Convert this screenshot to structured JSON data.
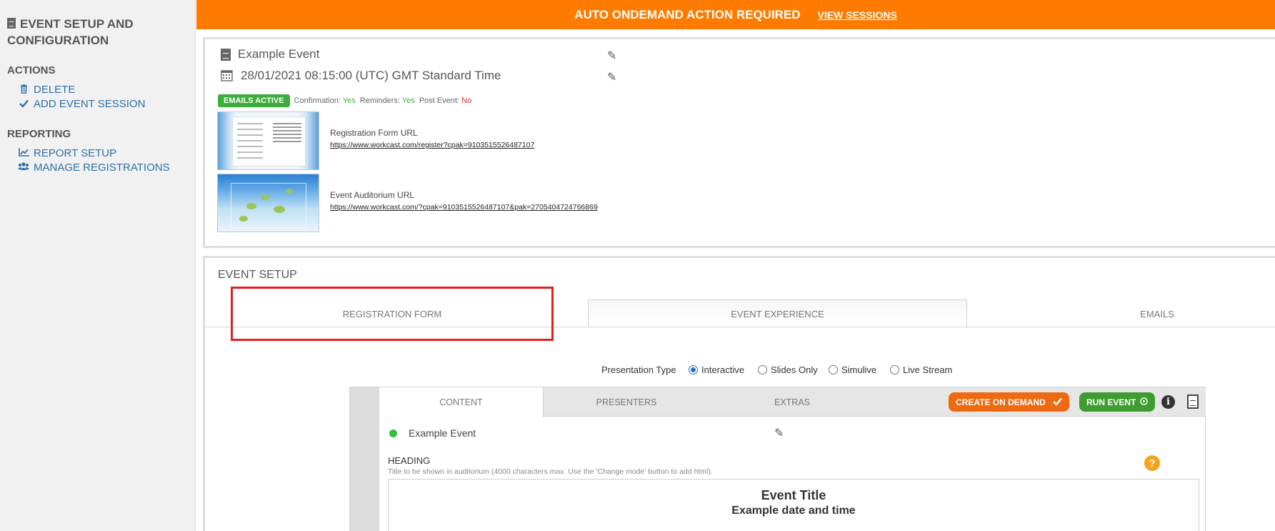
{
  "sidebar": {
    "title": "EVENT SETUP AND CONFIGURATION",
    "actions_heading": "ACTIONS",
    "actions": [
      {
        "label": "DELETE",
        "icon": "trash-icon"
      },
      {
        "label": "ADD EVENT SESSION",
        "icon": "check-icon"
      }
    ],
    "reporting_heading": "REPORTING",
    "reporting": [
      {
        "label": "REPORT SETUP",
        "icon": "chart-line-icon"
      },
      {
        "label": "MANAGE REGISTRATIONS",
        "icon": "users-icon"
      }
    ]
  },
  "banner": {
    "message": "AUTO ONDEMAND ACTION REQUIRED",
    "link": "VIEW SESSIONS",
    "color": "#ff7b00"
  },
  "summary": {
    "event_name": "Example Event",
    "datetime": "28/01/2021 08:15:00 (UTC) GMT Standard Time",
    "emails_badge": "EMAILS ACTIVE",
    "confirmation_label": "Confirmation:",
    "confirmation_value": "Yes",
    "reminders_label": "Reminders:",
    "reminders_value": "Yes",
    "post_event_label": "Post Event:",
    "post_event_value": "No",
    "registration_url_label": "Registration Form URL",
    "registration_url": "https://www.workcast.com/register?cpak=9103515526487107",
    "auditorium_url_label": "Event Auditorium URL",
    "auditorium_url": "https://www.workcast.com/?cpak=9103515526487107&pak=2705404724766869"
  },
  "setup": {
    "title": "EVENT SETUP",
    "tabs": [
      "REGISTRATION FORM",
      "EVENT EXPERIENCE",
      "EMAILS"
    ],
    "presentation_type_label": "Presentation Type",
    "presentation_types": [
      "Interactive",
      "Slides Only",
      "Simulive",
      "Live Stream"
    ],
    "selected_type": "Interactive",
    "sub_tabs": [
      "CONTENT",
      "PRESENTERS",
      "EXTRAS"
    ],
    "create_on_demand": "CREATE ON DEMAND",
    "run_event": "RUN EVENT",
    "content_event_name": "Example Event",
    "heading_label": "HEADING",
    "heading_help": "Title to be shown in auditorium (4000 characters max. Use the 'Change mode' button to add html).",
    "editor_title": "Event Title",
    "editor_subtitle": "Example date and time"
  }
}
